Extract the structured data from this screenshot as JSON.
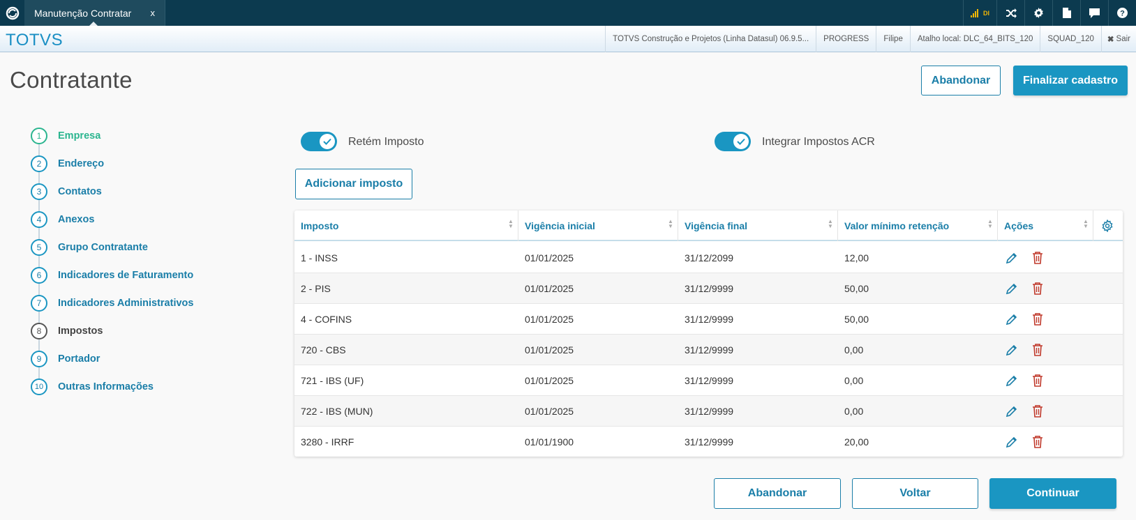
{
  "tab": {
    "title": "Manutenção Contratar",
    "close": "x"
  },
  "topbar_icons": {
    "signal_label": "DI"
  },
  "header": {
    "brand": "TOTVS",
    "info": [
      "TOTVS Construção e Projetos (Linha Datasul) 06.9.5...",
      "PROGRESS",
      "Filipe",
      "Atalho local: DLC_64_BITS_120",
      "SQUAD_120"
    ],
    "logout": "Sair"
  },
  "page": {
    "title": "Contratante",
    "abandon_label": "Abandonar",
    "finish_label": "Finalizar cadastro"
  },
  "steps": [
    {
      "n": "1",
      "label": "Empresa",
      "state": "done"
    },
    {
      "n": "2",
      "label": "Endereço",
      "state": "todo"
    },
    {
      "n": "3",
      "label": "Contatos",
      "state": "todo"
    },
    {
      "n": "4",
      "label": "Anexos",
      "state": "todo"
    },
    {
      "n": "5",
      "label": "Grupo Contratante",
      "state": "todo"
    },
    {
      "n": "6",
      "label": "Indicadores de Faturamento",
      "state": "todo"
    },
    {
      "n": "7",
      "label": "Indicadores Administrativos",
      "state": "todo"
    },
    {
      "n": "8",
      "label": "Impostos",
      "state": "current"
    },
    {
      "n": "9",
      "label": "Portador",
      "state": "todo"
    },
    {
      "n": "10",
      "label": "Outras Informações",
      "state": "todo"
    }
  ],
  "switches": {
    "retem": {
      "label": "Retém Imposto",
      "on": true
    },
    "integrar": {
      "label": "Integrar Impostos ACR",
      "on": true
    }
  },
  "add_tax_label": "Adicionar imposto",
  "table": {
    "headers": [
      "Imposto",
      "Vigência inicial",
      "Vigência final",
      "Valor mínimo retenção",
      "Ações"
    ],
    "rows": [
      [
        "1 - INSS",
        "01/01/2025",
        "31/12/2099",
        "12,00"
      ],
      [
        "2 - PIS",
        "01/01/2025",
        "31/12/9999",
        "50,00"
      ],
      [
        "4 - COFINS",
        "01/01/2025",
        "31/12/9999",
        "50,00"
      ],
      [
        "720 - CBS",
        "01/01/2025",
        "31/12/9999",
        "0,00"
      ],
      [
        "721 - IBS (UF)",
        "01/01/2025",
        "31/12/9999",
        "0,00"
      ],
      [
        "722 - IBS (MUN)",
        "01/01/2025",
        "31/12/9999",
        "0,00"
      ],
      [
        "3280 - IRRF",
        "01/01/1900",
        "31/12/9999",
        "20,00"
      ]
    ]
  },
  "footer": {
    "abandon_label": "Abandonar",
    "back_label": "Voltar",
    "continue_label": "Continuar"
  },
  "colors": {
    "primary": "#1a96c2",
    "done": "#2bb58f",
    "delete": "#c0392b",
    "topbar": "#0c3a4f"
  }
}
